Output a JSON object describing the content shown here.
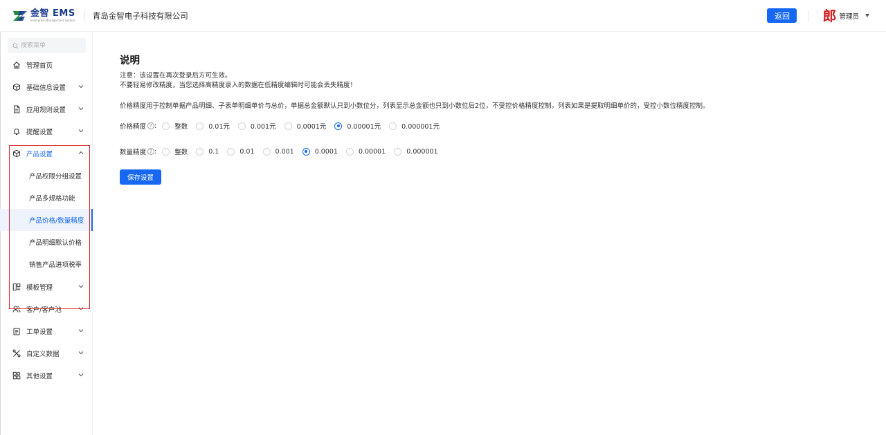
{
  "header": {
    "logo_text": "金智 EMS",
    "logo_sub": "Enterprise Management System",
    "company": "青岛金智电子科技有限公司",
    "back_label": "返回",
    "avatar_char": "郎",
    "user_name": "管理员"
  },
  "sidebar": {
    "search_placeholder": "搜索菜单",
    "items": [
      {
        "label": "管理首页"
      },
      {
        "label": "基础信息设置"
      },
      {
        "label": "应用规则设置"
      },
      {
        "label": "提醒设置"
      },
      {
        "label": "产品设置"
      },
      {
        "label": "模板管理"
      },
      {
        "label": "客户/客户池"
      },
      {
        "label": "工单设置"
      },
      {
        "label": "自定义数据"
      },
      {
        "label": "其他设置"
      }
    ],
    "sub_items": [
      {
        "label": "产品权限分组设置"
      },
      {
        "label": "产品多规格功能"
      },
      {
        "label": "产品价格/数量精度"
      },
      {
        "label": "产品明细默认价格"
      },
      {
        "label": "销售产品进项税率"
      }
    ]
  },
  "main": {
    "title": "说明",
    "notice_1": "注意：该设置在再次登录后方可生效。",
    "notice_2": "不要轻易修改精度，当您选择高精度录入的数据在低精度编辑时可能会丢失精度！",
    "description": "价格精度用于控制单据产品明细、子表单明细单价与总价，单据总金额默认只到小数位分，列表显示总金额也只到小数位后2位，不受控价格精度控制，列表如果是提取明细单价的，受控小数位精度控制。",
    "price_label": "价格精度",
    "price_options": [
      "整数",
      "0.01元",
      "0.001元",
      "0.0001元",
      "0.00001元",
      "0.000001元"
    ],
    "price_selected": "0.00001元",
    "qty_label": "数量精度",
    "qty_options": [
      "整数",
      "0.1",
      "0.01",
      "0.001",
      "0.0001",
      "0.00001",
      "0.000001"
    ],
    "qty_selected": "0.0001",
    "save_label": "保存设置"
  },
  "colors": {
    "primary": "#1668f2",
    "highlight_box": "#e02424",
    "avatar": "#cf1f1f"
  }
}
